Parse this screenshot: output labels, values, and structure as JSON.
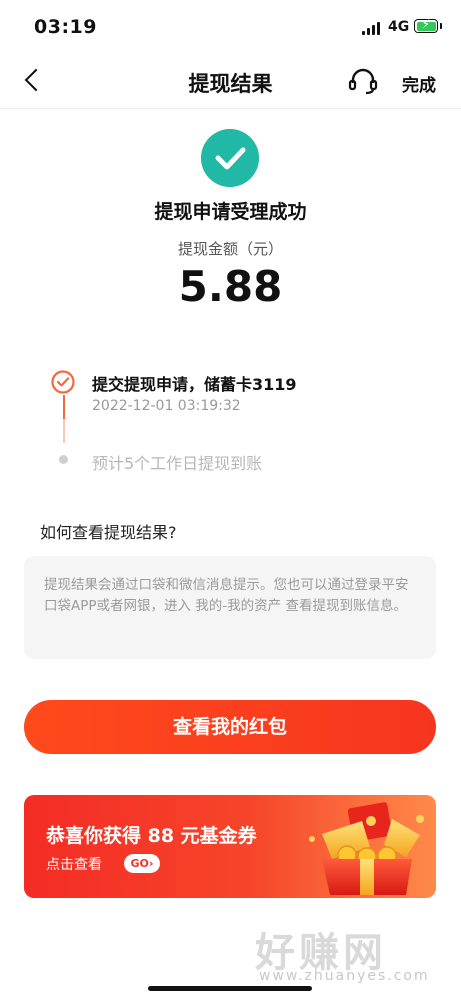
{
  "status_bar": {
    "time": "03:19",
    "network": "4G"
  },
  "nav": {
    "title": "提现结果",
    "done_label": "完成",
    "back_icon": "back-chevron-icon",
    "service_icon": "headset-icon"
  },
  "result": {
    "title": "提现申请受理成功",
    "amount_label": "提现金额（元）",
    "amount": "5.88",
    "status_color": "#22b8a6"
  },
  "timeline": [
    {
      "title": "提交提现申请，储蓄卡3119",
      "time": "2022-12-01 03:19:32",
      "state": "done"
    },
    {
      "title": "预计5个工作日提现到账",
      "state": "pending"
    }
  ],
  "faq": {
    "title": "如何查看提现结果?",
    "body": "提现结果会通过口袋和微信消息提示。您也可以通过登录平安口袋APP或者网银，进入 我的-我的资产 查看提现到账信息。"
  },
  "primary_button": {
    "label": "查看我的红包",
    "color": "#f7351f"
  },
  "coupon": {
    "title": "恭喜你获得 88 元基金券",
    "subtitle": "点击查看",
    "go_label": "GO",
    "go_icon": "chevron-right-icon"
  },
  "watermark": {
    "text": "好赚网",
    "url": "www.zhuanyes.com"
  }
}
